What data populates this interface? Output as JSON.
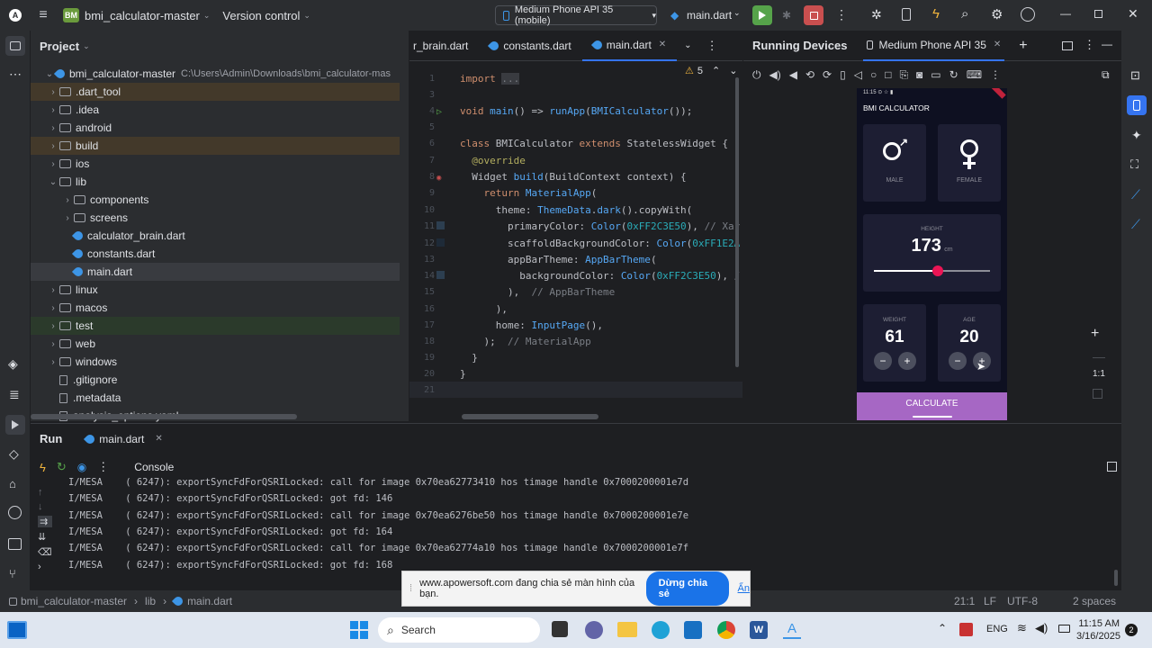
{
  "titlebar": {
    "project_badge": "BM",
    "project_name": "bmi_calculator-master",
    "version_control": "Version control",
    "device": "Medium Phone API 35 (mobile)",
    "run_config": "main.dart"
  },
  "project_panel": {
    "title": "Project",
    "root": "bmi_calculator-master",
    "root_path": "C:\\Users\\Admin\\Downloads\\bmi_calculator-mas",
    "items": [
      {
        "label": ".dart_tool"
      },
      {
        "label": ".idea"
      },
      {
        "label": "android"
      },
      {
        "label": "build"
      },
      {
        "label": "ios"
      },
      {
        "label": "lib"
      },
      {
        "label": "components"
      },
      {
        "label": "screens"
      },
      {
        "label": "calculator_brain.dart"
      },
      {
        "label": "constants.dart"
      },
      {
        "label": "main.dart"
      },
      {
        "label": "linux"
      },
      {
        "label": "macos"
      },
      {
        "label": "test"
      },
      {
        "label": "web"
      },
      {
        "label": "windows"
      },
      {
        "label": ".gitignore"
      },
      {
        "label": ".metadata"
      },
      {
        "label": "analysis_options.yaml"
      }
    ]
  },
  "editor": {
    "tabs": [
      "r_brain.dart",
      "constants.dart",
      "main.dart"
    ],
    "warning_count": "5",
    "lines": [
      "1",
      "3",
      "4",
      "5",
      "6",
      "7",
      "8",
      "9",
      "10",
      "11",
      "12",
      "13",
      "14",
      "15",
      "16",
      "17",
      "18",
      "19",
      "20",
      "21"
    ]
  },
  "devices": {
    "title": "Running Devices",
    "tab": "Medium Phone API 35",
    "zoom_label": "1:1"
  },
  "phone": {
    "status": "11:15 ⊙ ☆ ▮",
    "app_title": "BMI CALCULATOR",
    "male": "MALE",
    "female": "FEMALE",
    "height_label": "HEIGHT",
    "height_value": "173",
    "height_unit": "cm",
    "height_slider_fraction": 0.55,
    "weight_label": "WEIGHT",
    "weight_value": "61",
    "age_label": "AGE",
    "age_value": "20",
    "calculate": "CALCULATE"
  },
  "run": {
    "title": "Run",
    "tab": "main.dart",
    "console": "Console",
    "log": [
      "I/MESA    ( 6247): exportSyncFdForQSRILocked: call for image 0x70ea62773410 hos timage handle 0x7000200001e7d",
      "I/MESA    ( 6247): exportSyncFdForQSRILocked: got fd: 146",
      "I/MESA    ( 6247): exportSyncFdForQSRILocked: call for image 0x70ea6276be50 hos timage handle 0x7000200001e7e",
      "I/MESA    ( 6247): exportSyncFdForQSRILocked: got fd: 164",
      "I/MESA    ( 6247): exportSyncFdForQSRILocked: call for image 0x70ea62774a10 hos timage handle 0x7000200001e7f",
      "I/MESA    ( 6247): exportSyncFdForQSRILocked: got fd: 168"
    ]
  },
  "statusbar": {
    "crumb1": "bmi_calculator-master",
    "crumb2": "lib",
    "crumb3": "main.dart",
    "position": "21:1",
    "line_ending": "LF",
    "encoding": "UTF-8",
    "indent": "2 spaces"
  },
  "share_banner": {
    "text": "www.apowersoft.com đang chia sẻ màn hình của bạn.",
    "stop": "Dừng chia sẻ",
    "hide": "Ẩn"
  },
  "taskbar": {
    "search": "Search",
    "lang": "ENG",
    "time": "11:15 AM",
    "date": "3/16/2025",
    "notif": "2"
  }
}
